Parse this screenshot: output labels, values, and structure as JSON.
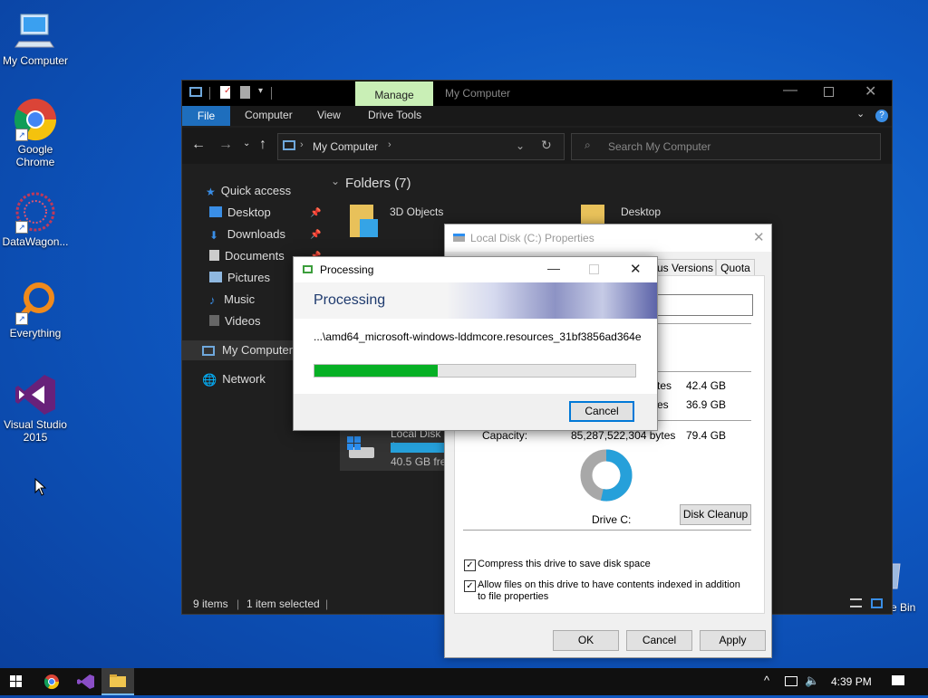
{
  "desktop": {
    "icons": [
      {
        "label": "My Computer"
      },
      {
        "label": "Google Chrome"
      },
      {
        "label": "DataWagon..."
      },
      {
        "label": "Everything"
      },
      {
        "label": "Visual Studio 2015"
      }
    ],
    "recycle_bin_partial": "e Bin"
  },
  "explorer": {
    "manage_tab": "Manage",
    "title": "My Computer",
    "ribbon_tabs": [
      "File",
      "Computer",
      "View",
      "Drive Tools"
    ],
    "address": "My Computer",
    "search_placeholder": "Search My Computer",
    "nav": {
      "quick_access": "Quick access",
      "items": [
        "Desktop",
        "Downloads",
        "Documents",
        "Pictures",
        "Music",
        "Videos"
      ],
      "my_computer": "My Computer",
      "network": "Network"
    },
    "section_header": "Folders (7)",
    "folders": [
      "3D Objects",
      "Desktop"
    ],
    "drive": {
      "label": "Local Disk (",
      "free": "40.5 GB free"
    },
    "status": {
      "items": "9 items",
      "selected": "1 item selected"
    }
  },
  "properties": {
    "title": "Local Disk (C:) Properties",
    "tabs_visible": [
      "ous Versions",
      "Quota"
    ],
    "used_tail": "tes",
    "used_size": "42.4 GB",
    "free_tail": "es",
    "free_size": "36.9 GB",
    "capacity_label": "Capacity:",
    "capacity_bytes": "85,287,522,304 bytes",
    "capacity_size": "79.4 GB",
    "drive_label": "Drive C:",
    "disk_cleanup": "Disk Cleanup",
    "compress_label": "Compress this drive to save disk space",
    "index_label": "Allow files on this drive to have contents indexed in addition to file properties",
    "ok": "OK",
    "cancel": "Cancel",
    "apply": "Apply",
    "used_fraction": 0.534,
    "colors": {
      "used": "#26a0da",
      "free": "#a8a8a8"
    }
  },
  "processing": {
    "title": "Processing",
    "heading": "Processing",
    "file": "...\\amd64_microsoft-windows-lddmcore.resources_31bf3856ad364e",
    "progress": 0.385,
    "cancel": "Cancel",
    "progress_color": "#06b025"
  },
  "taskbar": {
    "time": "4:39 PM"
  }
}
